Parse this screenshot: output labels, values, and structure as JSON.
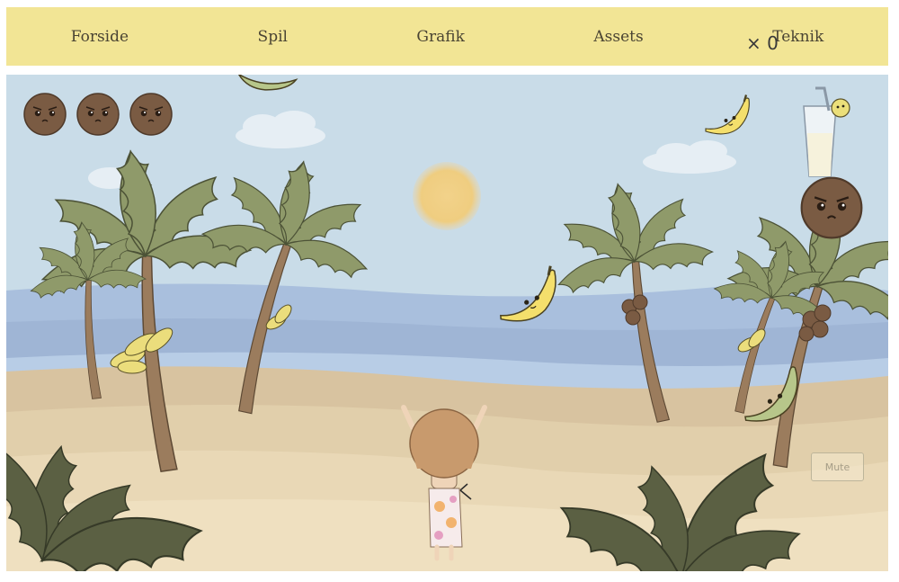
{
  "nav": {
    "items": [
      "Forside",
      "Spil",
      "Grafik",
      "Assets",
      "Teknik"
    ]
  },
  "hud": {
    "lives": 3,
    "banana_count": "× 0"
  },
  "controls": {
    "mute_label": "Mute"
  },
  "colors": {
    "nav_bg": "#f2e595",
    "sky": "#c9dce8",
    "sea": "#a9bfdd",
    "sand": "#e6d3ad",
    "sun": "#f0cf82"
  },
  "icons": [
    "coconut-life-icon",
    "banana-score-icon",
    "cocktail-glass-icon"
  ]
}
